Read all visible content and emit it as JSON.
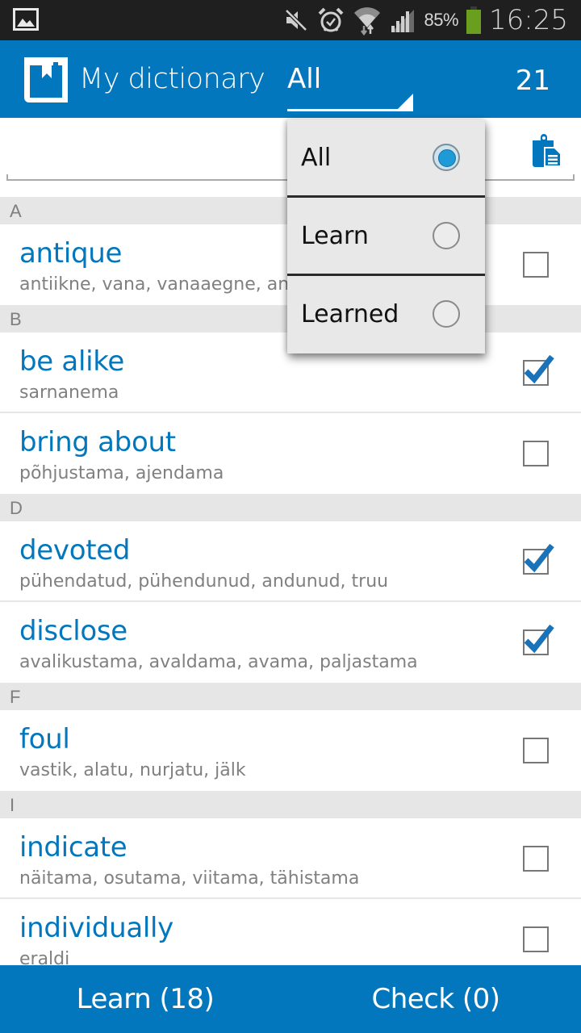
{
  "status_bar": {
    "notification_icon": "image-icon",
    "icons": [
      "mute-icon",
      "alarm-icon",
      "wifi-icon",
      "signal-icon"
    ],
    "battery_percent": "85%",
    "time": "16:25",
    "colors": {
      "battery": "#6a9e1f"
    }
  },
  "action_bar": {
    "title": "My dictionary",
    "app_icon": "book-bookmark-icon",
    "filter_value": "All",
    "word_count": "21",
    "colors": {
      "background": "#0277bd"
    }
  },
  "search": {
    "value": "",
    "placeholder": "",
    "paste_icon": "clipboard-icon"
  },
  "filter_dropdown": {
    "options": [
      {
        "label": "All",
        "selected": true
      },
      {
        "label": "Learn",
        "selected": false
      },
      {
        "label": "Learned",
        "selected": false
      }
    ]
  },
  "word_list": {
    "sections": [
      {
        "letter": "A",
        "words": [
          {
            "term": "antique",
            "translation": "antiikne, vana, vanaaegne, antiik",
            "learned": false
          }
        ]
      },
      {
        "letter": "B",
        "words": [
          {
            "term": "be alike",
            "translation": "sarnanema",
            "learned": true
          },
          {
            "term": "bring about",
            "translation": "põhjustama, ajendama",
            "learned": false
          }
        ]
      },
      {
        "letter": "D",
        "words": [
          {
            "term": "devoted",
            "translation": "pühendatud, pühendunud, andunud, truu",
            "learned": true
          },
          {
            "term": "disclose",
            "translation": "avalikustama, avaldama, avama, paljastama",
            "learned": true
          }
        ]
      },
      {
        "letter": "F",
        "words": [
          {
            "term": "foul",
            "translation": "vastik, alatu, nurjatu, jälk",
            "learned": false
          }
        ]
      },
      {
        "letter": "I",
        "words": [
          {
            "term": "indicate",
            "translation": "näitama, osutama, viitama, tähistama",
            "learned": false
          },
          {
            "term": "individually",
            "translation": "eraldi",
            "learned": false
          }
        ]
      }
    ],
    "colors": {
      "term": "#0277bd",
      "translation": "#808080",
      "section_bg": "#e6e6e6"
    }
  },
  "bottom_bar": {
    "learn_label": "Learn (18)",
    "check_label": "Check (0)"
  }
}
